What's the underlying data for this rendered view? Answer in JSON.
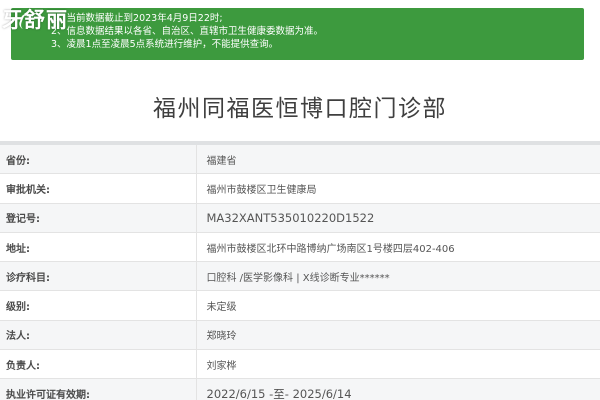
{
  "watermark": "牙舒丽",
  "notice": {
    "lines": [
      "1、当前数据截止到2023年4月9日22时;",
      "2、信息数据结果以各省、自治区、直辖市卫生健康委数据为准。",
      "3、凌晨1点至凌晨5点系统进行维护，不能提供查询。"
    ]
  },
  "hospital": {
    "name": "福州同福医恒博口腔门诊部"
  },
  "details": [
    {
      "label": "省份:",
      "value": "福建省"
    },
    {
      "label": "审批机关:",
      "value": "福州市鼓楼区卫生健康局"
    },
    {
      "label": "登记号:",
      "value": "MA32XANT535010220D1522"
    },
    {
      "label": "地址:",
      "value": "福州市鼓楼区北环中路博纳广场南区1号楼四层402-406"
    },
    {
      "label": "诊疗科目:",
      "value": "口腔科 /医学影像科 | X线诊断专业******"
    },
    {
      "label": "级别:",
      "value": "未定级"
    },
    {
      "label": "法人:",
      "value": "郑晓玲"
    },
    {
      "label": "负责人:",
      "value": "刘家桦"
    },
    {
      "label": "执业许可证有效期:",
      "value": "2022/6/15 -至- 2025/6/14"
    }
  ]
}
